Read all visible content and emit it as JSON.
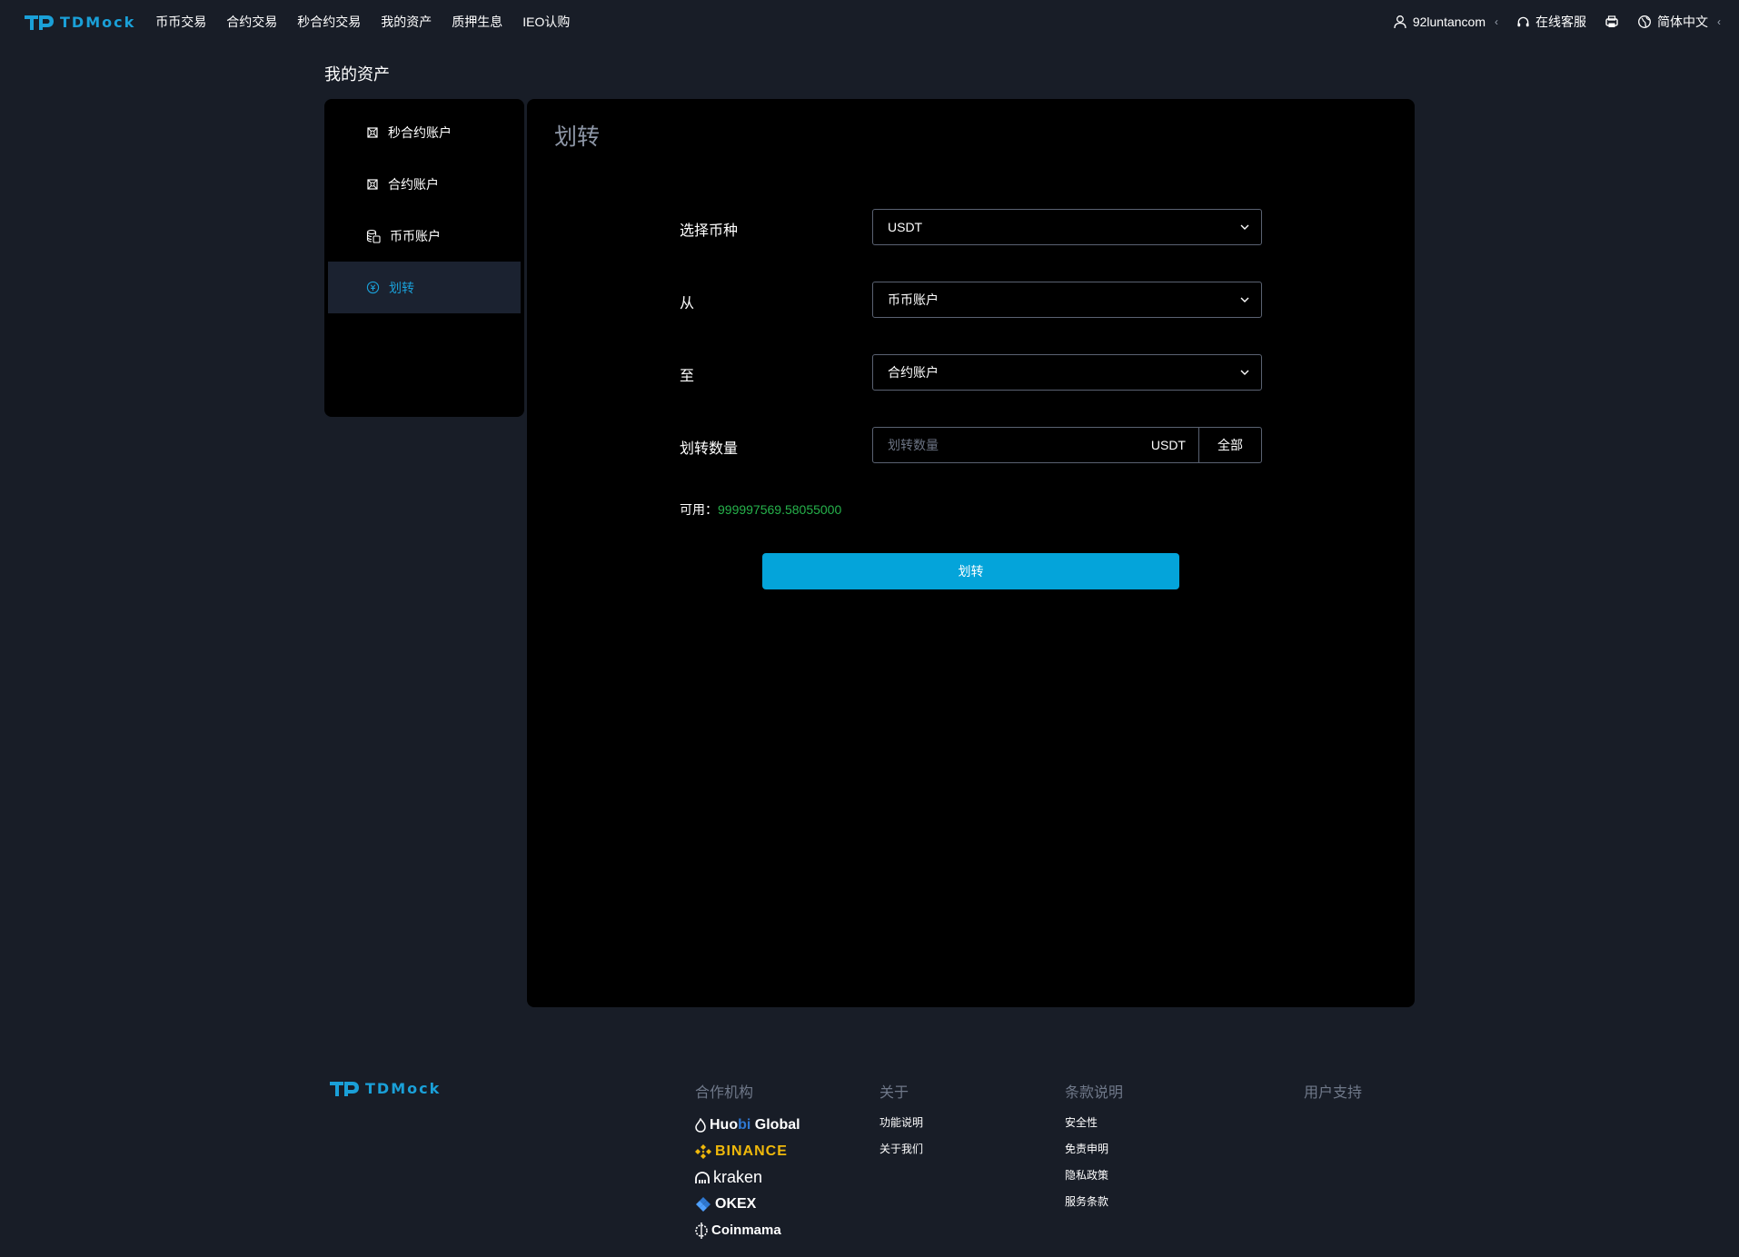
{
  "header": {
    "logo_text": "TDMock",
    "nav": [
      "币币交易",
      "合约交易",
      "秒合约交易",
      "我的资产",
      "质押生息",
      "IEO认购"
    ],
    "username": "92luntancom",
    "support": "在线客服",
    "language": "简体中文"
  },
  "page_title": "我的资产",
  "sidebar": {
    "items": [
      {
        "label": "秒合约账户",
        "icon": "contract-icon"
      },
      {
        "label": "合约账户",
        "icon": "contract-icon"
      },
      {
        "label": "币币账户",
        "icon": "coins-icon"
      },
      {
        "label": "划转",
        "icon": "transfer-icon",
        "active": true
      }
    ]
  },
  "transfer": {
    "title": "划转",
    "coin_label": "选择币种",
    "coin_value": "USDT",
    "from_label": "从",
    "from_value": "币币账户",
    "to_label": "至",
    "to_value": "合约账户",
    "amount_label": "划转数量",
    "amount_placeholder": "划转数量",
    "amount_unit": "USDT",
    "all_label": "全部",
    "available_label": "可用：",
    "available_value": "999997569.58055000",
    "submit_label": "划转"
  },
  "footer": {
    "logo_text": "TDMock",
    "partners_title": "合作机构",
    "partners": {
      "huobi_a": "Huo",
      "huobi_b": "bi",
      "huobi_c": " Global",
      "binance": "BINANCE",
      "kraken": "kraken",
      "okex": "OKEX",
      "coinmama": "Coinmama"
    },
    "about_title": "关于",
    "about_links": [
      "功能说明",
      "关于我们"
    ],
    "terms_title": "条款说明",
    "terms_links": [
      "安全性",
      "免责申明",
      "隐私政策",
      "服务条款"
    ],
    "support_title": "用户支持"
  },
  "colors": {
    "accent": "#04a4da",
    "available_green": "#26b24b",
    "page_bg": "#181d27",
    "panel_bg": "#000000"
  }
}
